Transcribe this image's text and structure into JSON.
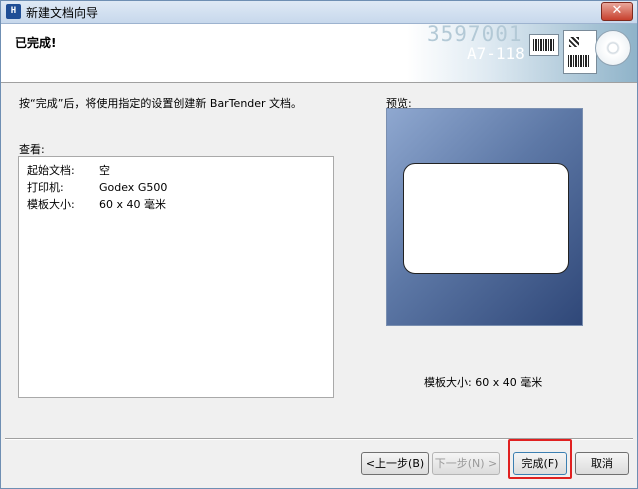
{
  "window": {
    "title": "新建文档向导",
    "app_icon": "bartender-app-icon",
    "close_glyph": "✕"
  },
  "header": {
    "title": "已完成!",
    "banner_number": "3597001",
    "banner_code": "A7-118"
  },
  "description": "按“完成”后，将使用指定的设置创建新 BarTender 文档。",
  "summary": {
    "label": "查看:",
    "rows": [
      {
        "key": "起始文档:",
        "value": "空"
      },
      {
        "key": "打印机:",
        "value": "Godex G500"
      },
      {
        "key": "模板大小:",
        "value": "60 x 40 毫米"
      }
    ]
  },
  "preview": {
    "label": "预览:",
    "size_label": "模板大小:",
    "size_value": "60 x 40 毫米"
  },
  "buttons": {
    "back": "<上一步(B)",
    "next": "下一步(N) >",
    "finish": "完成(F)",
    "cancel": "取消"
  },
  "colors": {
    "highlight": "#e02020",
    "preview_top": "#8fa8d0",
    "preview_bottom": "#2f4778"
  }
}
